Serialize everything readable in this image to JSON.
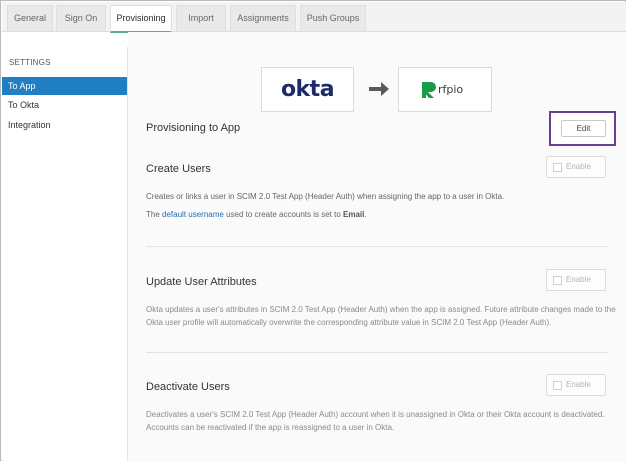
{
  "tabs": [
    {
      "label": "General",
      "active": false
    },
    {
      "label": "Sign On",
      "active": false
    },
    {
      "label": "Provisioning",
      "active": true
    },
    {
      "label": "Import",
      "active": false
    },
    {
      "label": "Assignments",
      "active": false
    },
    {
      "label": "Push Groups",
      "active": false
    }
  ],
  "sidebar": {
    "heading": "SETTINGS",
    "items": [
      {
        "label": "To App",
        "active": true
      },
      {
        "label": "To Okta",
        "active": false
      },
      {
        "label": "Integration",
        "active": false
      }
    ]
  },
  "header_logos": {
    "source": "okta",
    "target": "rfpio",
    "arrow_icon": "right-arrow-icon"
  },
  "provisioning": {
    "title": "Provisioning to App",
    "edit_label": "Edit"
  },
  "sections": {
    "create_users": {
      "title": "Create Users",
      "enable_label": "Enable",
      "description": "Creates or links a user in SCIM 2.0 Test App (Header Auth) when assigning the app to a user in Okta.",
      "note_prefix": "The ",
      "note_link": "default username",
      "note_middle": " used to create accounts is set to ",
      "note_value": "Email",
      "note_suffix": "."
    },
    "update_attributes": {
      "title": "Update User Attributes",
      "enable_label": "Enable",
      "description": "Okta updates a user's attributes in SCIM 2.0 Test App (Header Auth) when the app is assigned. Future attribute changes made to the Okta user profile will automatically overwrite the corresponding attribute value in SCIM 2.0 Test App (Header Auth)."
    },
    "deactivate_users": {
      "title": "Deactivate Users",
      "enable_label": "Enable",
      "description": "Deactivates a user's SCIM 2.0 Test App (Header Auth) account when it is unassigned in Okta or their Okta account is deactivated. Accounts can be reactivated if the app is reassigned to a user in Okta."
    }
  },
  "colors": {
    "active_tab_underline": "#5aae94",
    "sidebar_active": "#1f7fc2",
    "link": "#1f6fb5",
    "okta_brand": "#1d2b6b",
    "rfpio_brand": "#1a9a4a",
    "highlight_frame": "#6a3f8e"
  }
}
